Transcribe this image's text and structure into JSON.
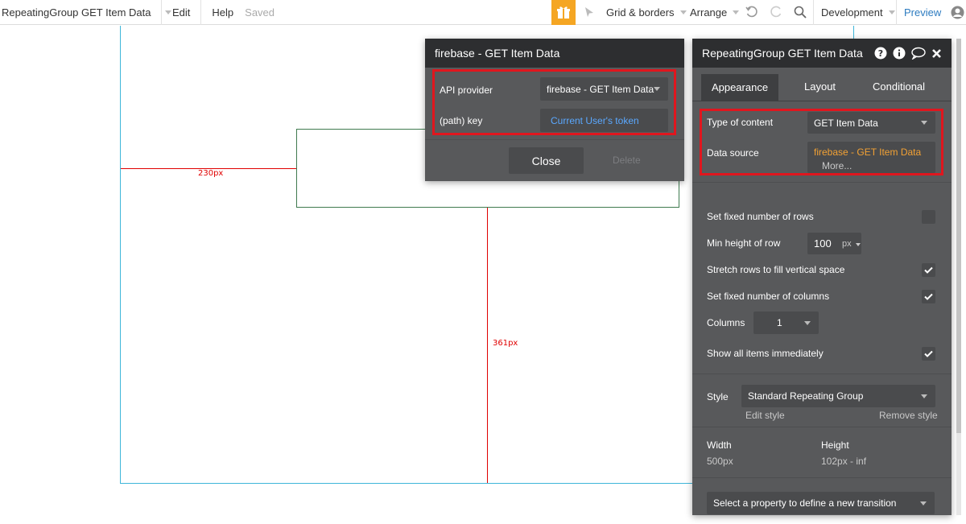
{
  "topbar": {
    "page_name": "RepeatingGroup GET Item Data",
    "edit": "Edit",
    "help": "Help",
    "saved": "Saved",
    "gift_icon": "gift-icon",
    "grid_borders": "Grid & borders",
    "arrange": "Arrange",
    "development": "Development",
    "preview": "Preview",
    "accent": "#f5a623"
  },
  "canvas": {
    "width_label": "230px",
    "height_label": "361px",
    "red": "#e00000"
  },
  "api_dialog": {
    "title": "firebase - GET Item Data",
    "api_provider_label": "API provider",
    "api_provider_value": "firebase - GET Item Data",
    "path_key_label": "(path) key",
    "path_key_value": "Current User's token",
    "close": "Close",
    "delete": "Delete"
  },
  "properties": {
    "title": "RepeatingGroup GET Item Data",
    "tabs": [
      "Appearance",
      "Layout",
      "Conditional"
    ],
    "type_of_content_label": "Type of content",
    "type_of_content_value": "GET Item Data",
    "data_source_label": "Data source",
    "data_source_value": "firebase - GET Item Data",
    "more": "More...",
    "fixed_rows_label": "Set fixed number of rows",
    "min_height_label": "Min height of row",
    "min_height_value": "100",
    "min_height_unit": "px",
    "stretch_label": "Stretch rows to fill vertical space",
    "fixed_columns_label": "Set fixed number of columns",
    "columns_label": "Columns",
    "columns_value": "1",
    "show_all_label": "Show all items immediately",
    "style_label": "Style",
    "style_value": "Standard Repeating Group",
    "edit_style": "Edit style",
    "remove_style": "Remove style",
    "width_label": "Width",
    "width_value": "500px",
    "height_label": "Height",
    "height_value": "102px - inf",
    "transition_placeholder": "Select a property to define a new transition",
    "checkbox_states": {
      "fixed_rows": false,
      "stretch": true,
      "fixed_columns": true,
      "show_all": true
    }
  }
}
